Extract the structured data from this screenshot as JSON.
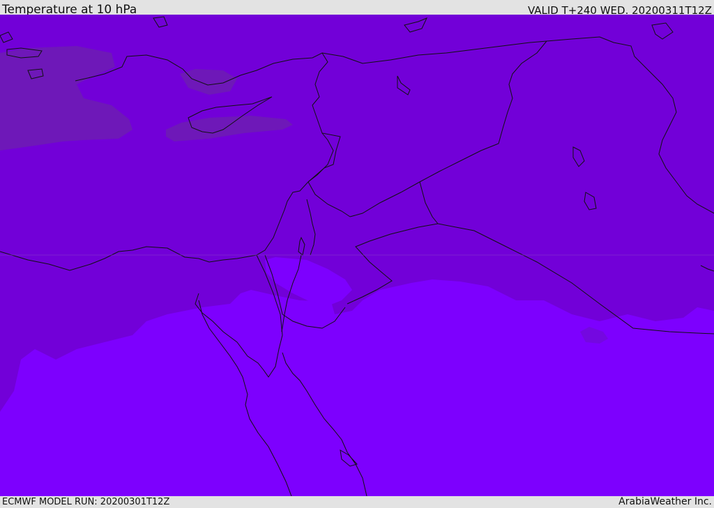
{
  "header": {
    "title": "Temperature at 10 hPa",
    "valid": "VALID T+240 WED. 20200311T12Z"
  },
  "footer": {
    "model_run": "ECMWF MODEL RUN: 20200301T12Z",
    "credit": "ArabiaWeather Inc."
  },
  "colors": {
    "band_warmer": "#7200d8",
    "band_mid": "#7a00f0",
    "band_cool": "#7d00fe",
    "band_warmest": "#6e18b8",
    "border_line": "#111111",
    "background": "#e3e3e3"
  }
}
